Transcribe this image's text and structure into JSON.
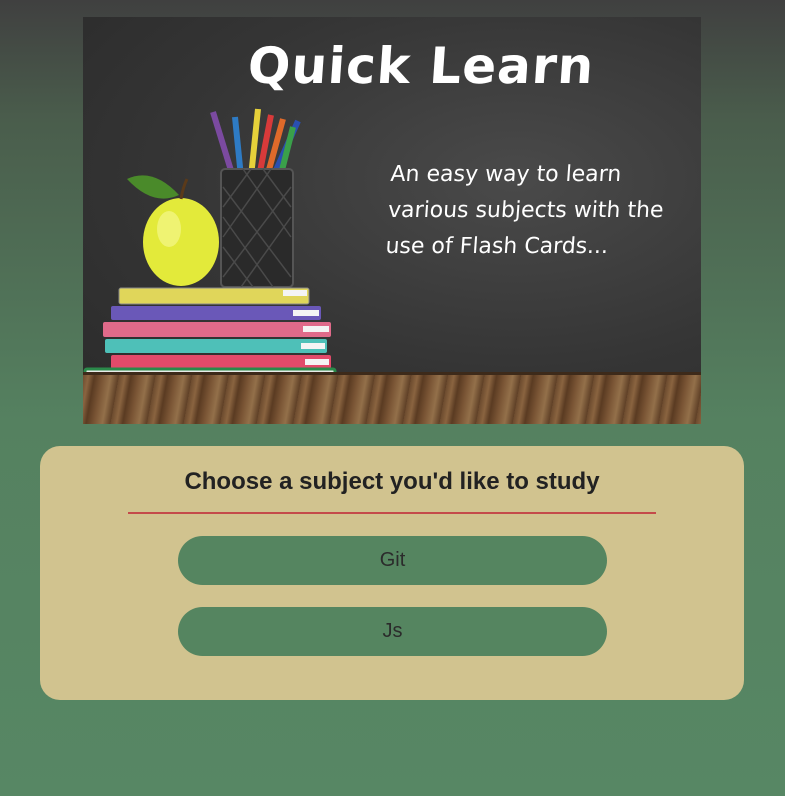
{
  "hero": {
    "title": "Quick Learn",
    "tagline_lines": [
      "An easy way to learn",
      "various subjects with the",
      "use of Flash Cards..."
    ]
  },
  "subject_panel": {
    "heading": "Choose a subject you'd like to study",
    "subjects": [
      {
        "label": "Git"
      },
      {
        "label": "Js"
      }
    ]
  },
  "colors": {
    "card_background": "#d1c38f",
    "button_background": "#558560",
    "divider": "#c44a4a",
    "page_background": "#578764"
  }
}
